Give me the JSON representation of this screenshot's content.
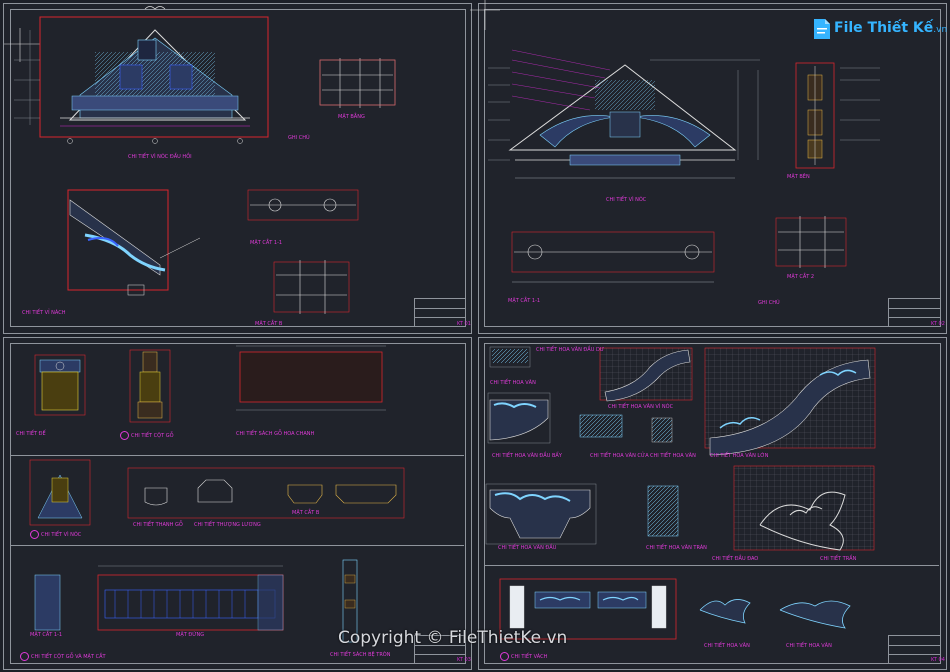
{
  "app": {
    "brand": {
      "name_part1": "File",
      "name_part2": "Thiết Kế",
      "domain": ".vn",
      "color": "#35b4ff"
    },
    "watermark": "Copyright © FileThietKe.vn"
  },
  "colors": {
    "background": "#1d2028",
    "frame": "#8f949c",
    "drawing_red": "#d8262e",
    "label_magenta": "#e03ad9",
    "ornament_cyan": "#7fd4ff",
    "ornament_blue": "#3a63ff",
    "dimension_grey": "#9aa0a8"
  },
  "sheets": {
    "top_left": {
      "sheet_no": "KT 01",
      "captions": {
        "main_elevation": "CHI TIẾT VÌ NÓC ĐẦU HỒI",
        "detail_plan": "MẶT BẰNG",
        "rafter_detail": "CHI TIẾT VỈ NÁCH",
        "beam_section": "MẶT CẮT 1-1",
        "frame_section": "MẶT CẮT B"
      },
      "notes_heading": "GHI CHÚ"
    },
    "top_right": {
      "sheet_no": "KT 02",
      "captions": {
        "main_elevation": "CHI TIẾT VÌ NÓC",
        "side_elevation": "MẶT BÊN",
        "beam_plan": "MẶT CẮT 1-1",
        "frame_plan": "MẶT CẮT 2"
      },
      "notes_heading": "GHI CHÚ"
    },
    "bottom_left": {
      "sheet_no": "KT 03",
      "captions": {
        "base_detail": "CHI TIẾT ĐẾ",
        "column_detail": "CHI TIẾT CỘT GỖ",
        "panel_detail": "CHI TIẾT SÁCH GỖ HOA CHANH",
        "roof_joint": "CHI TIẾT VÌ NÓC",
        "eave_beam": "CHI TIẾT THANH GỖ",
        "purlin_detail": "CHI TIẾT THƯỢNG LƯƠNG",
        "section_b": "MẶT CẮT B",
        "section_11": "MẶT CẮT 1-1",
        "elevation": "MẶT ĐỨNG",
        "column_section": "CHI TIẾT CỘT GỖ VÀ MẶT CẮT",
        "railing_detail": "CHI TIẾT SÁCH BỆ TRÒN"
      }
    },
    "bottom_right": {
      "sheet_no": "KT 04",
      "captions": {
        "ornament_a": "CHI TIẾT HOA VĂN ĐẦU DƯ",
        "ornament_b": "CHI TIẾT HOA VĂN",
        "ornament_c": "CHI TIẾT HOA VĂN VÌ NÓC",
        "ornament_d": "CHI TIẾT HOA VĂN ĐẦU BẨY",
        "ornament_e": "CHI TIẾT HOA VĂN CỬA",
        "ornament_f": "CHI TIẾT HOA VĂN",
        "ornament_g": "CHI TIẾT HOA VĂN LỚN",
        "ornament_h": "CHI TIẾT HOA VĂN ĐẦU",
        "ornament_i": "CHI TIẾT HOA VĂN TRÁN",
        "ornament_j": "CHI TIẾT ĐẦU ĐAO",
        "ornament_k": "CHI TIẾT TRẦN",
        "beam_panel": "CHI TIẾT VÁCH",
        "dragon_left": "CHI TIẾT HOA VĂN",
        "dragon_right": "CHI TIẾT HOA VĂN"
      }
    }
  }
}
